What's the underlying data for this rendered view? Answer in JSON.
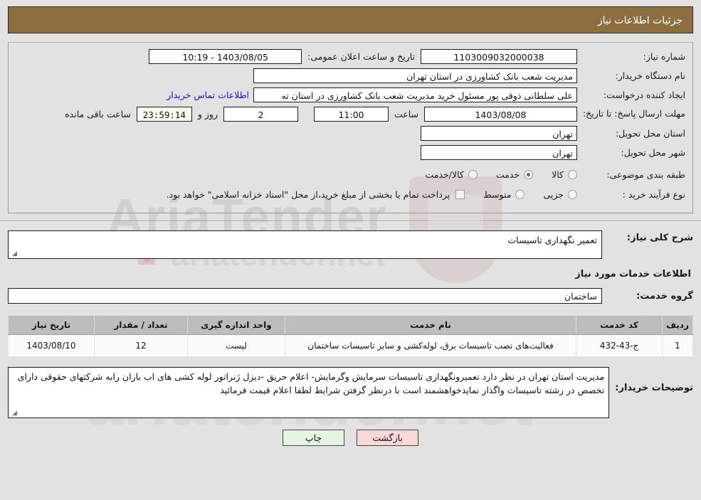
{
  "header": {
    "title": "جزئیات اطلاعات نیاز"
  },
  "info": {
    "need_number_label": "شماره نیاز:",
    "need_number": "1103009032000038",
    "announce_label": "تاریخ و ساعت اعلان عمومی:",
    "announce_value": "1403/08/05 - 10:19",
    "buyer_org_label": "نام دستگاه خریدار:",
    "buyer_org": "مدیریت شعب بانک کشاورزی در استان تهران",
    "creator_label": "ایجاد کننده درخواست:",
    "creator": "علی سلطانی ذوقی پور مسئول خرید مدیریت شعب بانک کشاورزی در استان ته",
    "contact_link": "اطلاعات تماس خریدار",
    "deadline_label": "مهلت ارسال پاسخ: تا تاریخ:",
    "deadline_date": "1403/08/08",
    "hour_label": "ساعت",
    "deadline_hour": "11:00",
    "days_value": "2",
    "days_label": "روز و",
    "timer_value": "23:59:14",
    "remaining_label": "ساعت باقی مانده",
    "province_label": "استان محل تحویل:",
    "province": "تهران",
    "city_label": "شهر محل تحویل:",
    "city": "تهران",
    "category_label": "طبقه بندی موضوعی:",
    "category_options": [
      {
        "label": "کالا",
        "selected": false
      },
      {
        "label": "خدمت",
        "selected": true
      },
      {
        "label": "کالا/خدمت",
        "selected": false
      }
    ],
    "process_label": "نوع فرآیند خرید :",
    "process_options": [
      {
        "label": "جزیی",
        "selected": false
      },
      {
        "label": "متوسط",
        "selected": false
      }
    ],
    "treasury_note": "پرداخت تمام یا بخشی از مبلغ خرید،از محل \"اسناد خزانه اسلامی\" خواهد بود."
  },
  "description": {
    "label": "شرح کلی نیاز:",
    "value": "تعمیر  نگهداری تاسیسات"
  },
  "services_section": {
    "heading": "اطلاعات خدمات مورد نیاز",
    "group_label": "گروه خدمت:",
    "group_value": "ساختمان"
  },
  "table": {
    "columns": [
      "ردیف",
      "کد خدمت",
      "نام خدمت",
      "واحد اندازه گیری",
      "تعداد / مقدار",
      "تاریخ نیاز"
    ],
    "rows": [
      {
        "radif": "1",
        "code": "ج-43-432",
        "name": "فعالیت‌های نصب تاسیسات برق، لوله‌کشی و سایر تاسیسات ساختمان",
        "unit": "لیست",
        "qty": "12",
        "date": "1403/08/10"
      }
    ]
  },
  "notes": {
    "label": "توضیحات خریدار:",
    "value": "مدیریت استان تهران در نظر دارد تعمیرونگهداری تاسیسات سرمایش وگرمایش- اعلام حریق -دیزل ژنراتور لوله کشی های اب باران رابه شرکتهای حقوقی دارای تخصص در رشته تاسیسات واگذار نمایدخواهشمند است با درنظر گرفتن شرایط  لطفا اعلام قیمت فرمائید"
  },
  "buttons": {
    "print": "چاپ",
    "back": "بازگشت"
  },
  "watermark": {
    "brand": "AriaTender",
    "site": "ariatender.net",
    "mark": "aTender"
  },
  "colors": {
    "header_bg": "#8d6e41",
    "link": "#1414d0",
    "print_bg": "#e4f5e0",
    "back_bg": "#f9d8d8",
    "table_header_bg": "#bdbdbd"
  }
}
